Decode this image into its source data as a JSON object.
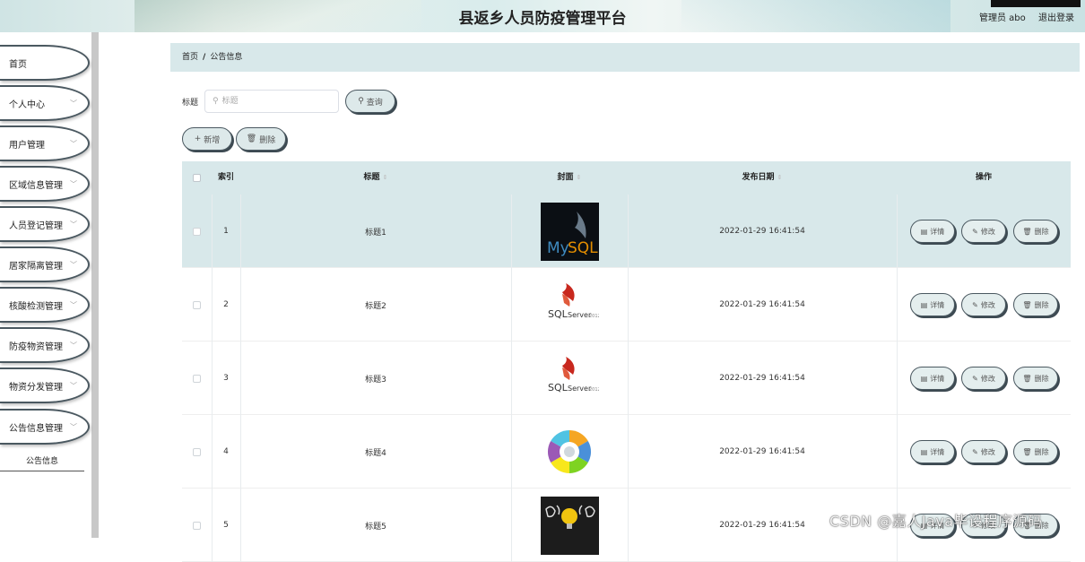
{
  "header": {
    "title": "县返乡人员防疫管理平台",
    "admin": "管理员 abo",
    "logout": "退出登录"
  },
  "sidebar": {
    "items": [
      {
        "label": "首页"
      },
      {
        "label": "个人中心"
      },
      {
        "label": "用户管理"
      },
      {
        "label": "区域信息管理"
      },
      {
        "label": "人员登记管理"
      },
      {
        "label": "居家隔离管理"
      },
      {
        "label": "核酸检测管理"
      },
      {
        "label": "防疫物资管理"
      },
      {
        "label": "物资分发管理"
      },
      {
        "label": "公告信息管理"
      }
    ],
    "sub_item": "公告信息"
  },
  "breadcrumb": {
    "home": "首页",
    "separator": "/",
    "current": "公告信息"
  },
  "search": {
    "label": "标题",
    "placeholder": "标题",
    "query_button": "查询"
  },
  "toolbar": {
    "add_button": "新增",
    "delete_button": "删除"
  },
  "table": {
    "columns": {
      "index": "索引",
      "title": "标题",
      "cover": "封面",
      "date": "发布日期",
      "actions": "操作"
    },
    "rows": [
      {
        "index": "1",
        "title": "标题1",
        "cover": "mysql-logo",
        "date": "2022-01-29 16:41:54"
      },
      {
        "index": "2",
        "title": "标题2",
        "cover": "sqlserver-logo",
        "date": "2022-01-29 16:41:54"
      },
      {
        "index": "3",
        "title": "标题3",
        "cover": "sqlserver-logo",
        "date": "2022-01-29 16:41:54"
      },
      {
        "index": "4",
        "title": "标题4",
        "cover": "wheel-diagram",
        "date": "2022-01-29 16:41:54"
      },
      {
        "index": "5",
        "title": "标题5",
        "cover": "dark-bulb-image",
        "date": "2022-01-29 16:41:54"
      }
    ],
    "row_actions": {
      "detail": "详情",
      "edit": "修改",
      "delete": "删除"
    }
  },
  "watermark": "CSDN @嘉人Java毕设程序源码",
  "colors": {
    "accent_bg": "#d8e8ea",
    "button_border": "#4a5860",
    "button_bg": "#dde9ea"
  }
}
